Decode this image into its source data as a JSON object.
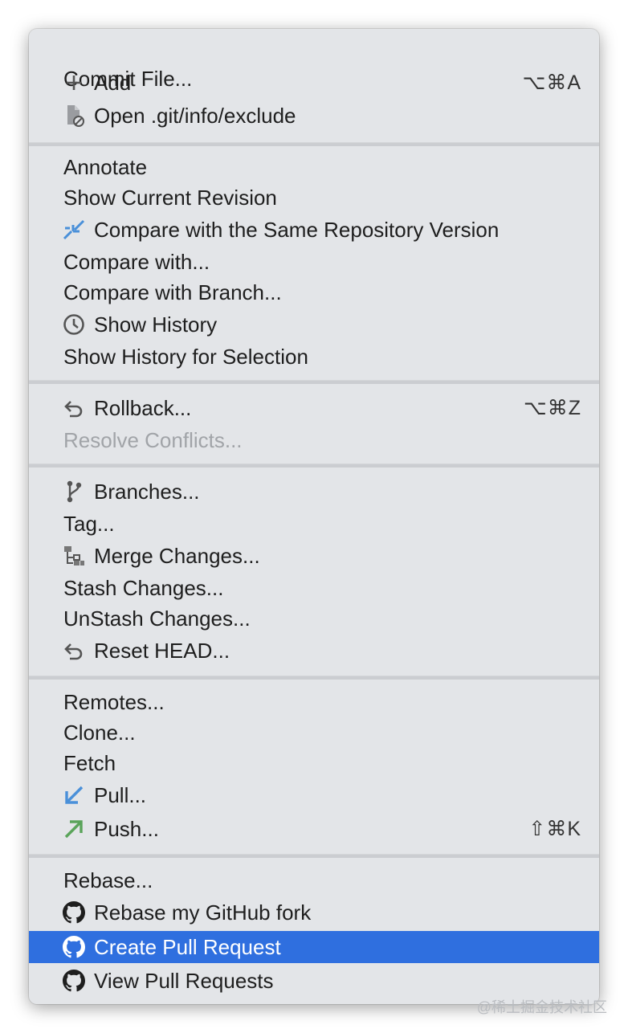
{
  "menu": {
    "items": [
      {
        "label": "Commit File...",
        "shortcut": ""
      },
      {
        "label": "Add",
        "shortcut": "⌥⌘A",
        "icon": "plus-icon"
      },
      {
        "label": "Open .git/info/exclude",
        "shortcut": "",
        "icon": "file-ignore-icon"
      },
      {
        "label": "Annotate",
        "shortcut": ""
      },
      {
        "label": "Show Current Revision",
        "shortcut": ""
      },
      {
        "label": "Compare with the Same Repository Version",
        "shortcut": "",
        "icon": "compare-arrows-icon"
      },
      {
        "label": "Compare with...",
        "shortcut": ""
      },
      {
        "label": "Compare with Branch...",
        "shortcut": ""
      },
      {
        "label": "Show History",
        "shortcut": "",
        "icon": "clock-icon"
      },
      {
        "label": "Show History for Selection",
        "shortcut": ""
      },
      {
        "label": "Rollback...",
        "shortcut": "⌥⌘Z",
        "icon": "undo-icon"
      },
      {
        "label": "Resolve Conflicts...",
        "shortcut": "",
        "disabled": true
      },
      {
        "label": "Branches...",
        "shortcut": "",
        "icon": "branch-icon"
      },
      {
        "label": "Tag...",
        "shortcut": ""
      },
      {
        "label": "Merge Changes...",
        "shortcut": "",
        "icon": "merge-tree-icon"
      },
      {
        "label": "Stash Changes...",
        "shortcut": ""
      },
      {
        "label": "UnStash Changes...",
        "shortcut": ""
      },
      {
        "label": "Reset HEAD...",
        "shortcut": "",
        "icon": "undo-icon"
      },
      {
        "label": "Remotes...",
        "shortcut": ""
      },
      {
        "label": "Clone...",
        "shortcut": ""
      },
      {
        "label": "Fetch",
        "shortcut": ""
      },
      {
        "label": "Pull...",
        "shortcut": "",
        "icon": "pull-arrow-icon"
      },
      {
        "label": "Push...",
        "shortcut": "⇧⌘K",
        "icon": "push-arrow-icon"
      },
      {
        "label": "Rebase...",
        "shortcut": ""
      },
      {
        "label": "Rebase my GitHub fork",
        "shortcut": "",
        "icon": "github-icon"
      },
      {
        "label": "Create Pull Request",
        "shortcut": "",
        "icon": "github-icon",
        "highlighted": true
      },
      {
        "label": "View Pull Requests",
        "shortcut": "",
        "icon": "github-icon"
      }
    ]
  },
  "colors": {
    "menu_bg": "#e3e5e8",
    "highlight": "#2f6fdf",
    "disabled_text": "#a1a4a8",
    "pull_arrow": "#4a90d9",
    "push_arrow": "#5aa45a"
  },
  "watermark": "@稀土掘金技术社区"
}
